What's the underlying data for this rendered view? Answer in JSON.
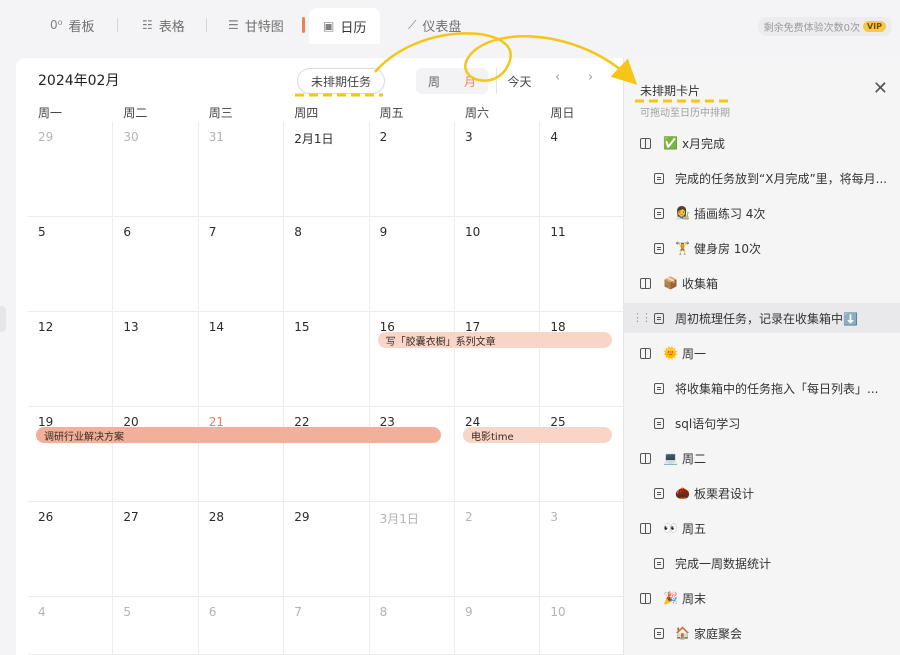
{
  "tabs": [
    {
      "label": "看板",
      "icon": "0⁰"
    },
    {
      "label": "表格",
      "icon": "☷"
    },
    {
      "label": "甘特图",
      "icon": "☰"
    },
    {
      "label": "日历",
      "icon": "▣"
    },
    {
      "label": "仪表盘",
      "icon": "⟋"
    }
  ],
  "vip": {
    "note": "剩余免费体验次数0次",
    "badge": "VIP"
  },
  "calendar": {
    "title": "2024年02月",
    "unscheduled_button": "未排期任务",
    "view_week": "周",
    "view_month": "月",
    "today": "今天",
    "prev": "‹",
    "next": "›",
    "weekdays": [
      "周一",
      "周二",
      "周三",
      "周四",
      "周五",
      "周六",
      "周日"
    ],
    "weeks": [
      [
        {
          "d": "29",
          "t": "dim"
        },
        {
          "d": "30",
          "t": "dim"
        },
        {
          "d": "31",
          "t": "dim"
        },
        {
          "d": "2月1日",
          "t": ""
        },
        {
          "d": "2",
          "t": ""
        },
        {
          "d": "3",
          "t": ""
        },
        {
          "d": "4",
          "t": ""
        }
      ],
      [
        {
          "d": "5",
          "t": ""
        },
        {
          "d": "6",
          "t": ""
        },
        {
          "d": "7",
          "t": ""
        },
        {
          "d": "8",
          "t": ""
        },
        {
          "d": "9",
          "t": ""
        },
        {
          "d": "10",
          "t": ""
        },
        {
          "d": "11",
          "t": ""
        }
      ],
      [
        {
          "d": "12",
          "t": ""
        },
        {
          "d": "13",
          "t": ""
        },
        {
          "d": "14",
          "t": ""
        },
        {
          "d": "15",
          "t": ""
        },
        {
          "d": "16",
          "t": ""
        },
        {
          "d": "17",
          "t": ""
        },
        {
          "d": "18",
          "t": ""
        }
      ],
      [
        {
          "d": "19",
          "t": ""
        },
        {
          "d": "20",
          "t": ""
        },
        {
          "d": "21",
          "t": "red"
        },
        {
          "d": "22",
          "t": ""
        },
        {
          "d": "23",
          "t": ""
        },
        {
          "d": "24",
          "t": ""
        },
        {
          "d": "25",
          "t": ""
        }
      ],
      [
        {
          "d": "26",
          "t": ""
        },
        {
          "d": "27",
          "t": ""
        },
        {
          "d": "28",
          "t": ""
        },
        {
          "d": "29",
          "t": ""
        },
        {
          "d": "3月1日",
          "t": "dim"
        },
        {
          "d": "2",
          "t": "dim"
        },
        {
          "d": "3",
          "t": "dim"
        }
      ],
      [
        {
          "d": "4",
          "t": "dim"
        },
        {
          "d": "5",
          "t": "dim"
        },
        {
          "d": "6",
          "t": "dim"
        },
        {
          "d": "7",
          "t": "dim"
        },
        {
          "d": "8",
          "t": "dim"
        },
        {
          "d": "9",
          "t": "dim"
        },
        {
          "d": "10",
          "t": "dim"
        }
      ]
    ],
    "events": [
      {
        "label": "写「胶囊衣橱」系列文章",
        "week": 2,
        "start": 4,
        "end": 6,
        "style": "light"
      },
      {
        "label": "调研行业解决方案",
        "week": 3,
        "start": 0,
        "end": 4,
        "style": "strong"
      },
      {
        "label": "电影time",
        "week": 3,
        "start": 5,
        "end": 6,
        "style": "light"
      }
    ]
  },
  "panel": {
    "title": "未排期卡片",
    "subtitle": "可拖动至日历中排期",
    "close": "✕",
    "rows": [
      {
        "kind": "group",
        "emoji": "✅",
        "text": "x月完成"
      },
      {
        "kind": "item",
        "emoji": "",
        "text": "完成的任务放到“X月完成”里，将每月..."
      },
      {
        "kind": "item",
        "emoji": "👩‍🎨",
        "text": "插画练习 4次"
      },
      {
        "kind": "item",
        "emoji": "🏋",
        "text": "健身房 10次"
      },
      {
        "kind": "group",
        "emoji": "📦",
        "text": "收集箱"
      },
      {
        "kind": "item",
        "emoji": "",
        "text": "周初梳理任务，记录在收集箱中⬇️",
        "hl": true
      },
      {
        "kind": "group",
        "emoji": "🌞",
        "text": "周一"
      },
      {
        "kind": "item",
        "emoji": "",
        "text": "将收集箱中的任务拖入「每日列表」..."
      },
      {
        "kind": "item",
        "emoji": "",
        "text": "sql语句学习"
      },
      {
        "kind": "group",
        "emoji": "💻",
        "text": "周二"
      },
      {
        "kind": "item",
        "emoji": "🌰",
        "text": "板栗君设计"
      },
      {
        "kind": "group",
        "emoji": "👀",
        "text": "周五"
      },
      {
        "kind": "item",
        "emoji": "",
        "text": "完成一周数据统计"
      },
      {
        "kind": "group",
        "emoji": "🎉",
        "text": "周末"
      },
      {
        "kind": "item",
        "emoji": "🏠",
        "text": "家庭聚会"
      }
    ]
  },
  "colors": {
    "accent": "#e8845a",
    "annotation": "#f5c518"
  }
}
